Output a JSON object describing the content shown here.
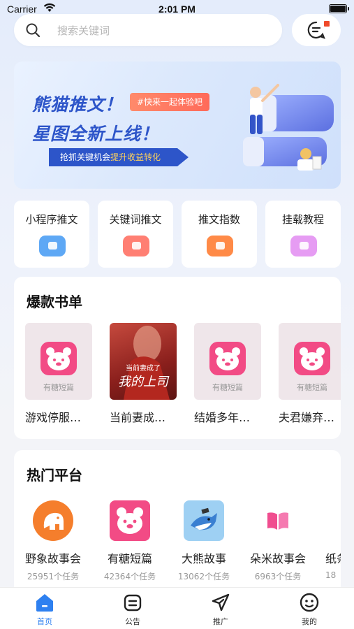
{
  "status_bar": {
    "carrier": "Carrier",
    "time": "2:01 PM"
  },
  "search": {
    "placeholder": "搜索关键词"
  },
  "banner": {
    "title_line1": "熊猫推文！",
    "title_line2": "星图全新上线！",
    "tag": "#快来一起体验吧",
    "ribbon_prefix": "抢抓关键机会",
    "ribbon_highlight": "提升收益转化"
  },
  "quick_links": [
    {
      "label": "小程序推文",
      "icon": "miniprogram-icon",
      "color": "#5ea8f5"
    },
    {
      "label": "关键词推文",
      "icon": "keyword-icon",
      "color": "#ff7f73"
    },
    {
      "label": "推文指数",
      "icon": "index-icon",
      "color": "#ff8a47"
    },
    {
      "label": "挂载教程",
      "icon": "tutorial-icon",
      "color": "#e69cf3"
    }
  ],
  "hot_books": {
    "title": "爆款书单",
    "items": [
      {
        "name": "游戏停服…",
        "cover": "有糖短篇"
      },
      {
        "name": "当前妻成…",
        "cover_line1": "当前妻成了",
        "cover_line2": "我的上司"
      },
      {
        "name": "结婚多年…",
        "cover": "有糖短篇"
      },
      {
        "name": "夫君嫌弃…",
        "cover": "有糖短篇"
      }
    ]
  },
  "platforms": {
    "title": "热门平台",
    "items": [
      {
        "name": "野象故事会",
        "tasks": "25951个任务",
        "icon": "elephant-icon"
      },
      {
        "name": "有糖短篇",
        "tasks": "42364个任务",
        "icon": "bear-icon"
      },
      {
        "name": "大熊故事",
        "tasks": "13062个任务",
        "icon": "shark-icon"
      },
      {
        "name": "朵米故事会",
        "tasks": "6963个任务",
        "icon": "book-icon"
      },
      {
        "name": "纸条",
        "tasks": "18",
        "icon": "paper-icon"
      }
    ]
  },
  "tabbar": [
    {
      "label": "首页",
      "active": true
    },
    {
      "label": "公告",
      "active": false
    },
    {
      "label": "推广",
      "active": false
    },
    {
      "label": "我的",
      "active": false
    }
  ],
  "colors": {
    "accent": "#2e80f0",
    "brand_blue": "#2d55c9",
    "bear_pink": "#f24b85"
  }
}
